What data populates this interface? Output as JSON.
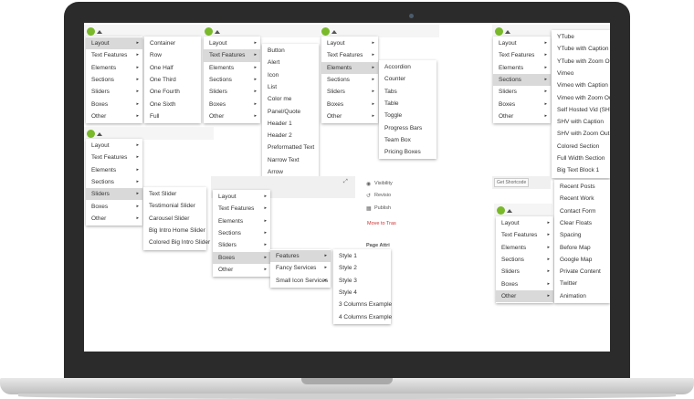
{
  "icons": {
    "logo": "green-logo-circle",
    "caret": "caret-up-icon",
    "expand": "expand-arrows-icon",
    "submenu": "chevron-right-icon"
  },
  "colors": {
    "logo": "#79b92a",
    "highlight": "#d9d9d9",
    "trash": "#cc3333"
  },
  "main_menu": [
    "Layout",
    "Text Features",
    "Elements",
    "Sections",
    "Sliders",
    "Boxes",
    "Other"
  ],
  "layout_sub": [
    "Container",
    "Row",
    "One Half",
    "One Third",
    "One Fourth",
    "One Sixth",
    "Full"
  ],
  "text_features_sub": [
    "Button",
    "Alert",
    "Icon",
    "List",
    "Color me",
    "Panel/Quote",
    "Header 1",
    "Header 2",
    "Preformatted Text",
    "Narrow Text",
    "Arrow"
  ],
  "elements_sub": [
    "Accordion",
    "Counter",
    "Tabs",
    "Table",
    "Toggle",
    "Progress Bars",
    "Team Box",
    "Pricing Boxes"
  ],
  "sections_sub": [
    "YTube",
    "YTube with Caption",
    "YTube with Zoom Out",
    "Vimeo",
    "Vimeo with Caption",
    "Vimeo with Zoom Out",
    "Self Hosted Vid (SHV)",
    "SHV with Caption",
    "SHV with Zoom Out",
    "Colored Section",
    "Full Width Section",
    "Big Text Block 1"
  ],
  "sliders_sub": [
    "Text Slider",
    "Testimonial Slider",
    "Carousel Slider",
    "Big Intro Home Slider",
    "Colored Big Intro Slider"
  ],
  "boxes_sub": [
    "Features",
    "Fancy Services",
    "Small Icon Services"
  ],
  "features_sub": [
    "Style 1",
    "Style 2",
    "Style 3",
    "Style 4",
    "3 Columns Example",
    "4 Columns Example"
  ],
  "other_sub": [
    "Recent Posts",
    "Recent Work",
    "Contact Form",
    "Clear Floats",
    "Spacing",
    "Before Map",
    "Google Map",
    "Private Content",
    "Twitter",
    "Animation"
  ],
  "get_shortcode": "Get Shortcode",
  "sidebar": {
    "visibility": "Visibility",
    "revisions": "Revisio",
    "publish": "Publish",
    "move_trash": "Move to Tras",
    "page_attr": "Page Attri"
  }
}
